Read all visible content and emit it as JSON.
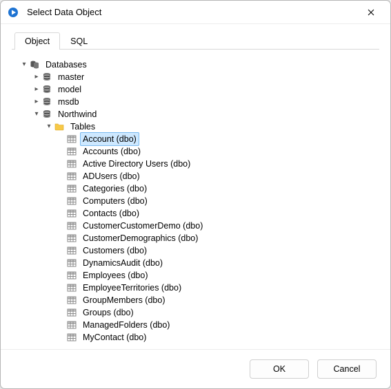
{
  "window": {
    "title": "Select Data Object"
  },
  "tabs": {
    "object": "Object",
    "sql": "SQL",
    "active": "object"
  },
  "tree": {
    "root_label": "Databases",
    "databases": [
      {
        "name": "master",
        "expanded": false
      },
      {
        "name": "model",
        "expanded": false
      },
      {
        "name": "msdb",
        "expanded": false
      },
      {
        "name": "Northwind",
        "expanded": true,
        "folders": [
          {
            "name": "Tables",
            "expanded": true,
            "tables": [
              "Account (dbo)",
              "Accounts (dbo)",
              "Active Directory Users (dbo)",
              "ADUsers (dbo)",
              "Categories (dbo)",
              "Computers (dbo)",
              "Contacts (dbo)",
              "CustomerCustomerDemo (dbo)",
              "CustomerDemographics (dbo)",
              "Customers (dbo)",
              "DynamicsAudit (dbo)",
              "Employees (dbo)",
              "EmployeeTerritories (dbo)",
              "GroupMembers (dbo)",
              "Groups (dbo)",
              "ManagedFolders (dbo)",
              "MyContact (dbo)"
            ]
          }
        ]
      }
    ],
    "selected_table": "Account (dbo)"
  },
  "footer": {
    "ok": "OK",
    "cancel": "Cancel"
  }
}
